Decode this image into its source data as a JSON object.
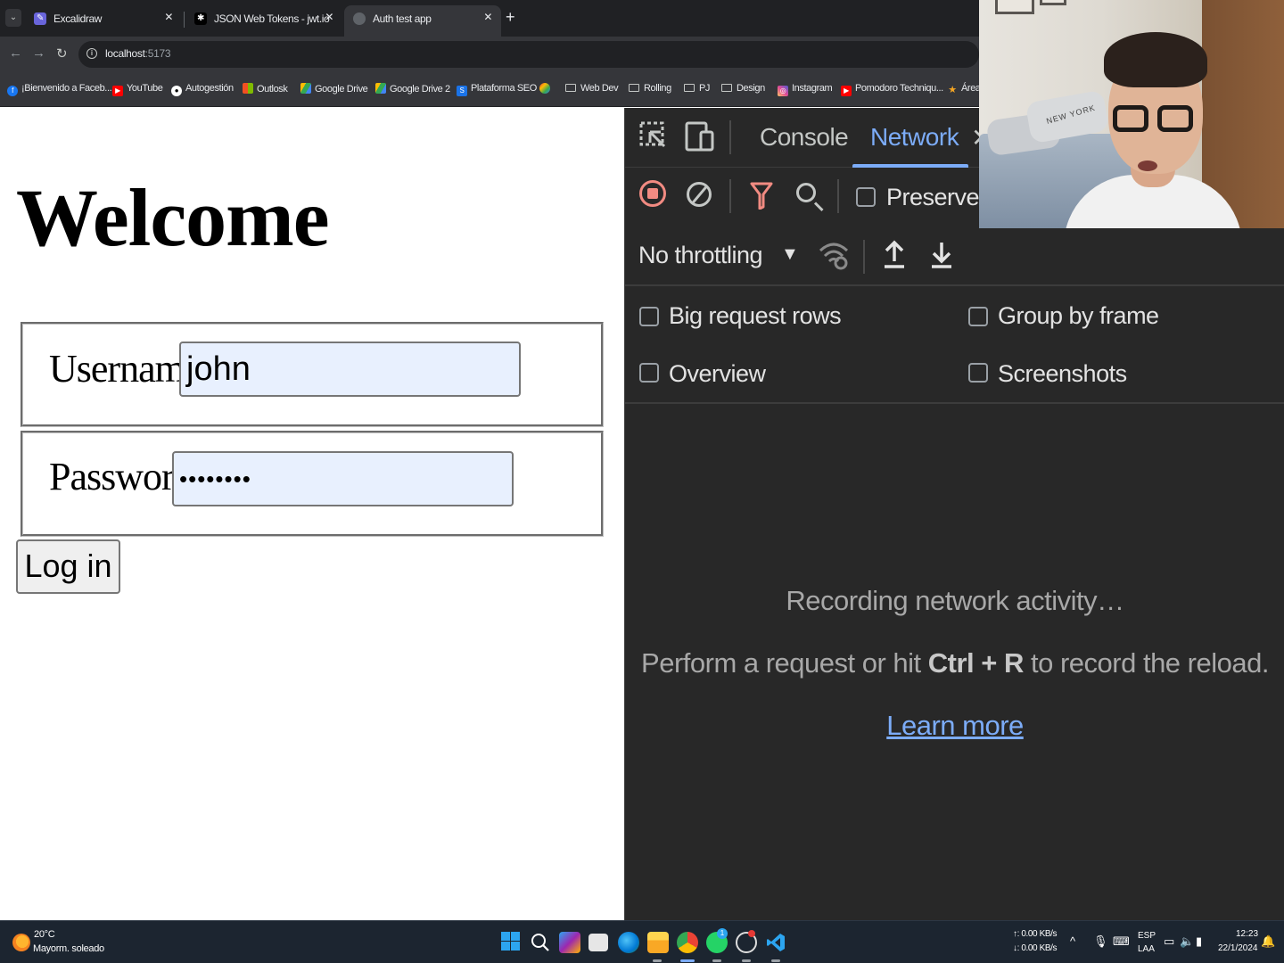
{
  "browser": {
    "tabs": [
      {
        "title": "Excalidraw",
        "active": false,
        "favicon_color": "#6965db"
      },
      {
        "title": "JSON Web Tokens - jwt.io",
        "active": false,
        "favicon_color": "#000000"
      },
      {
        "title": "Auth test app",
        "active": true,
        "favicon_color": "#9aa0a6"
      }
    ],
    "tab_close_glyph": "✕",
    "new_tab_glyph": "+",
    "url_host": "localhost",
    "url_port": ":5173",
    "bookmarks": [
      {
        "label": "¡Bienvenido a Faceb...",
        "icon": "facebook-icon",
        "color": "#1877f2"
      },
      {
        "label": "YouTube",
        "icon": "youtube-icon",
        "color": "#ff0000"
      },
      {
        "label": "Autogestión",
        "icon": "github-icon",
        "color": "#ffffff"
      },
      {
        "label": "Outlosk",
        "icon": "microsoft-icon",
        "color": "#f25022"
      },
      {
        "label": "Google Drive",
        "icon": "drive-icon",
        "color": "#34a853"
      },
      {
        "label": "Google Drive 2",
        "icon": "drive-icon",
        "color": "#34a853"
      },
      {
        "label": "Plataforma SEO",
        "icon": "seo-icon",
        "color": "#1a73e8"
      },
      {
        "label": "",
        "icon": "app-icon",
        "color": "#34a853"
      },
      {
        "label": "Web Dev",
        "icon": "folder-icon"
      },
      {
        "label": "Rolling",
        "icon": "folder-icon"
      },
      {
        "label": "PJ",
        "icon": "folder-icon"
      },
      {
        "label": "Design",
        "icon": "folder-icon"
      },
      {
        "label": "Instagram",
        "icon": "instagram-icon",
        "color": "#e1306c"
      },
      {
        "label": "Pomodoro Techniqu...",
        "icon": "youtube-icon",
        "color": "#ff0000"
      },
      {
        "label": "Área",
        "icon": "star-icon",
        "color": "#f5a623"
      }
    ]
  },
  "page": {
    "heading": "Welcome",
    "username_label": "Username",
    "username_value": "john",
    "password_label": "Password",
    "password_value": "••••••••",
    "login_label": "Log in"
  },
  "devtools": {
    "tabs": {
      "console": "Console",
      "network": "Network"
    },
    "preserve_log": "Preserve lo",
    "throttling": "No throttling",
    "options": {
      "big_rows": "Big request rows",
      "group_by_frame": "Group by frame",
      "overview": "Overview",
      "screenshots": "Screenshots"
    },
    "empty_title": "Recording network activity…",
    "empty_sub_prefix": "Perform a request or hit ",
    "empty_sub_shortcut": "Ctrl + R",
    "empty_sub_suffix": " to record the reload.",
    "learn_more": "Learn more"
  },
  "webcam": {
    "pillow_text": "NEW YORK"
  },
  "taskbar": {
    "weather_temp": "20°C",
    "weather_cond": "Mayorm. soleado",
    "net_up": "↑: 0.00 KB/s",
    "net_down": "↓: 0.00 KB/s",
    "lang_1": "ESP",
    "lang_2": "LAA",
    "time": "12:23",
    "date": "22/1/2024",
    "whatsapp_badge": "1"
  }
}
